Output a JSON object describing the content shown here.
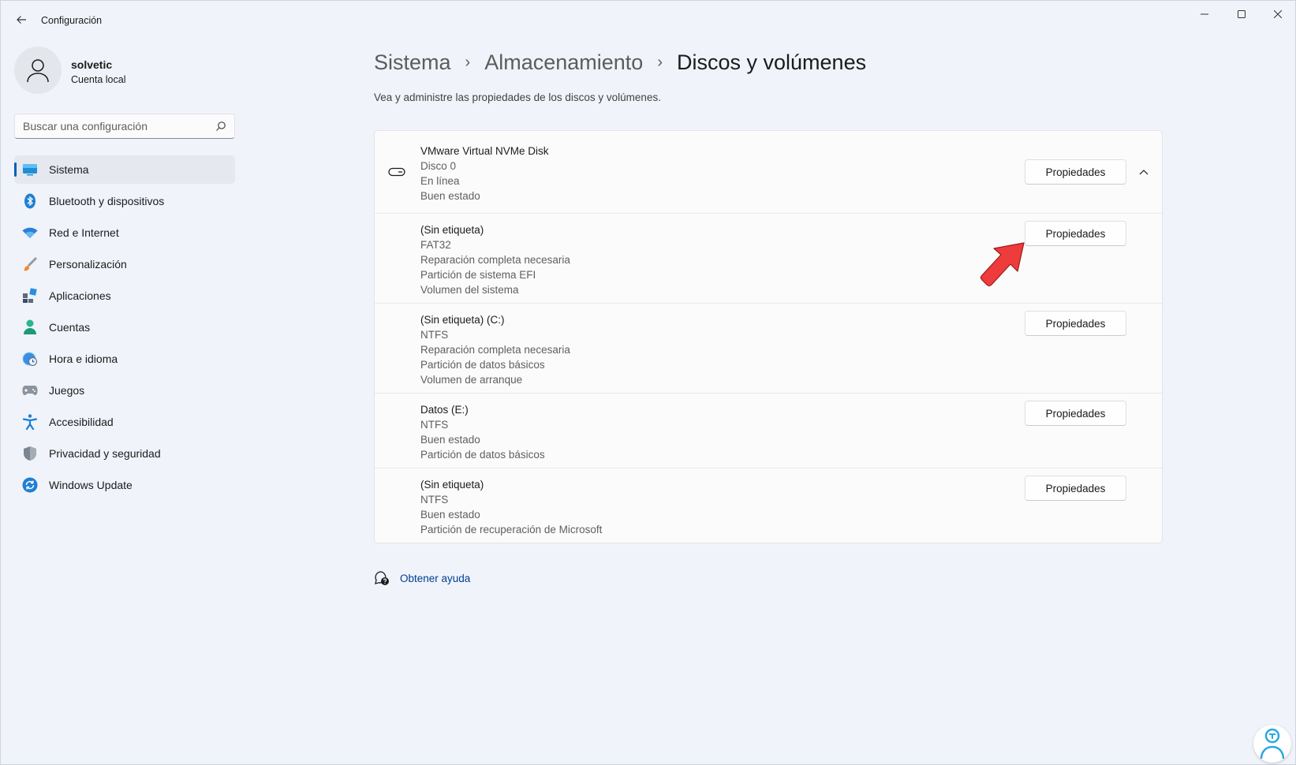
{
  "window": {
    "title": "Configuración",
    "controls": [
      "minimize-icon",
      "maximize-icon",
      "close-icon"
    ]
  },
  "profile": {
    "name": "solvetic",
    "account_type": "Cuenta local"
  },
  "search": {
    "placeholder": "Buscar una configuración",
    "value": ""
  },
  "sidebar": {
    "selected": "Sistema",
    "items": [
      {
        "label": "Sistema",
        "icon": "system-display-icon"
      },
      {
        "label": "Bluetooth y dispositivos",
        "icon": "bluetooth-icon"
      },
      {
        "label": "Red e Internet",
        "icon": "wifi-icon"
      },
      {
        "label": "Personalización",
        "icon": "paintbrush-icon"
      },
      {
        "label": "Aplicaciones",
        "icon": "apps-icon"
      },
      {
        "label": "Cuentas",
        "icon": "person-icon"
      },
      {
        "label": "Hora e idioma",
        "icon": "globe-clock-icon"
      },
      {
        "label": "Juegos",
        "icon": "gamepad-icon"
      },
      {
        "label": "Accesibilidad",
        "icon": "accessibility-icon"
      },
      {
        "label": "Privacidad y seguridad",
        "icon": "shield-icon"
      },
      {
        "label": "Windows Update",
        "icon": "refresh-icon"
      }
    ]
  },
  "breadcrumb": {
    "items": [
      "Sistema",
      "Almacenamiento",
      "Discos y volúmenes"
    ],
    "separator": "›"
  },
  "page": {
    "description": "Vea y administre las propiedades de los discos y volúmenes."
  },
  "disk": {
    "icon": "disk-drive-icon",
    "expanded": true,
    "lines": [
      "VMware Virtual NVMe Disk",
      "Disco 0",
      "En línea",
      "Buen estado"
    ],
    "button_label": "Propiedades"
  },
  "volumes": [
    {
      "lines": [
        "(Sin etiqueta)",
        "FAT32",
        "Reparación completa necesaria",
        "Partición de sistema EFI",
        "Volumen del sistema"
      ],
      "button_label": "Propiedades"
    },
    {
      "lines": [
        "(Sin etiqueta) (C:)",
        "NTFS",
        "Reparación completa necesaria",
        "Partición de datos básicos",
        "Volumen de arranque"
      ],
      "button_label": "Propiedades"
    },
    {
      "lines": [
        "Datos (E:)",
        "NTFS",
        "Buen estado",
        "Partición de datos básicos"
      ],
      "button_label": "Propiedades"
    },
    {
      "lines": [
        "(Sin etiqueta)",
        "NTFS",
        "Buen estado",
        "Partición de recuperación de Microsoft"
      ],
      "button_label": "Propiedades"
    }
  ],
  "help": {
    "label": "Obtener ayuda",
    "icon": "help-chat-icon"
  },
  "annotation": {
    "icon": "red-arrow-icon",
    "color": "#ee3b3b"
  },
  "colors": {
    "accent": "#005fb8",
    "link": "#003e92",
    "background": "#f0f3f9"
  }
}
